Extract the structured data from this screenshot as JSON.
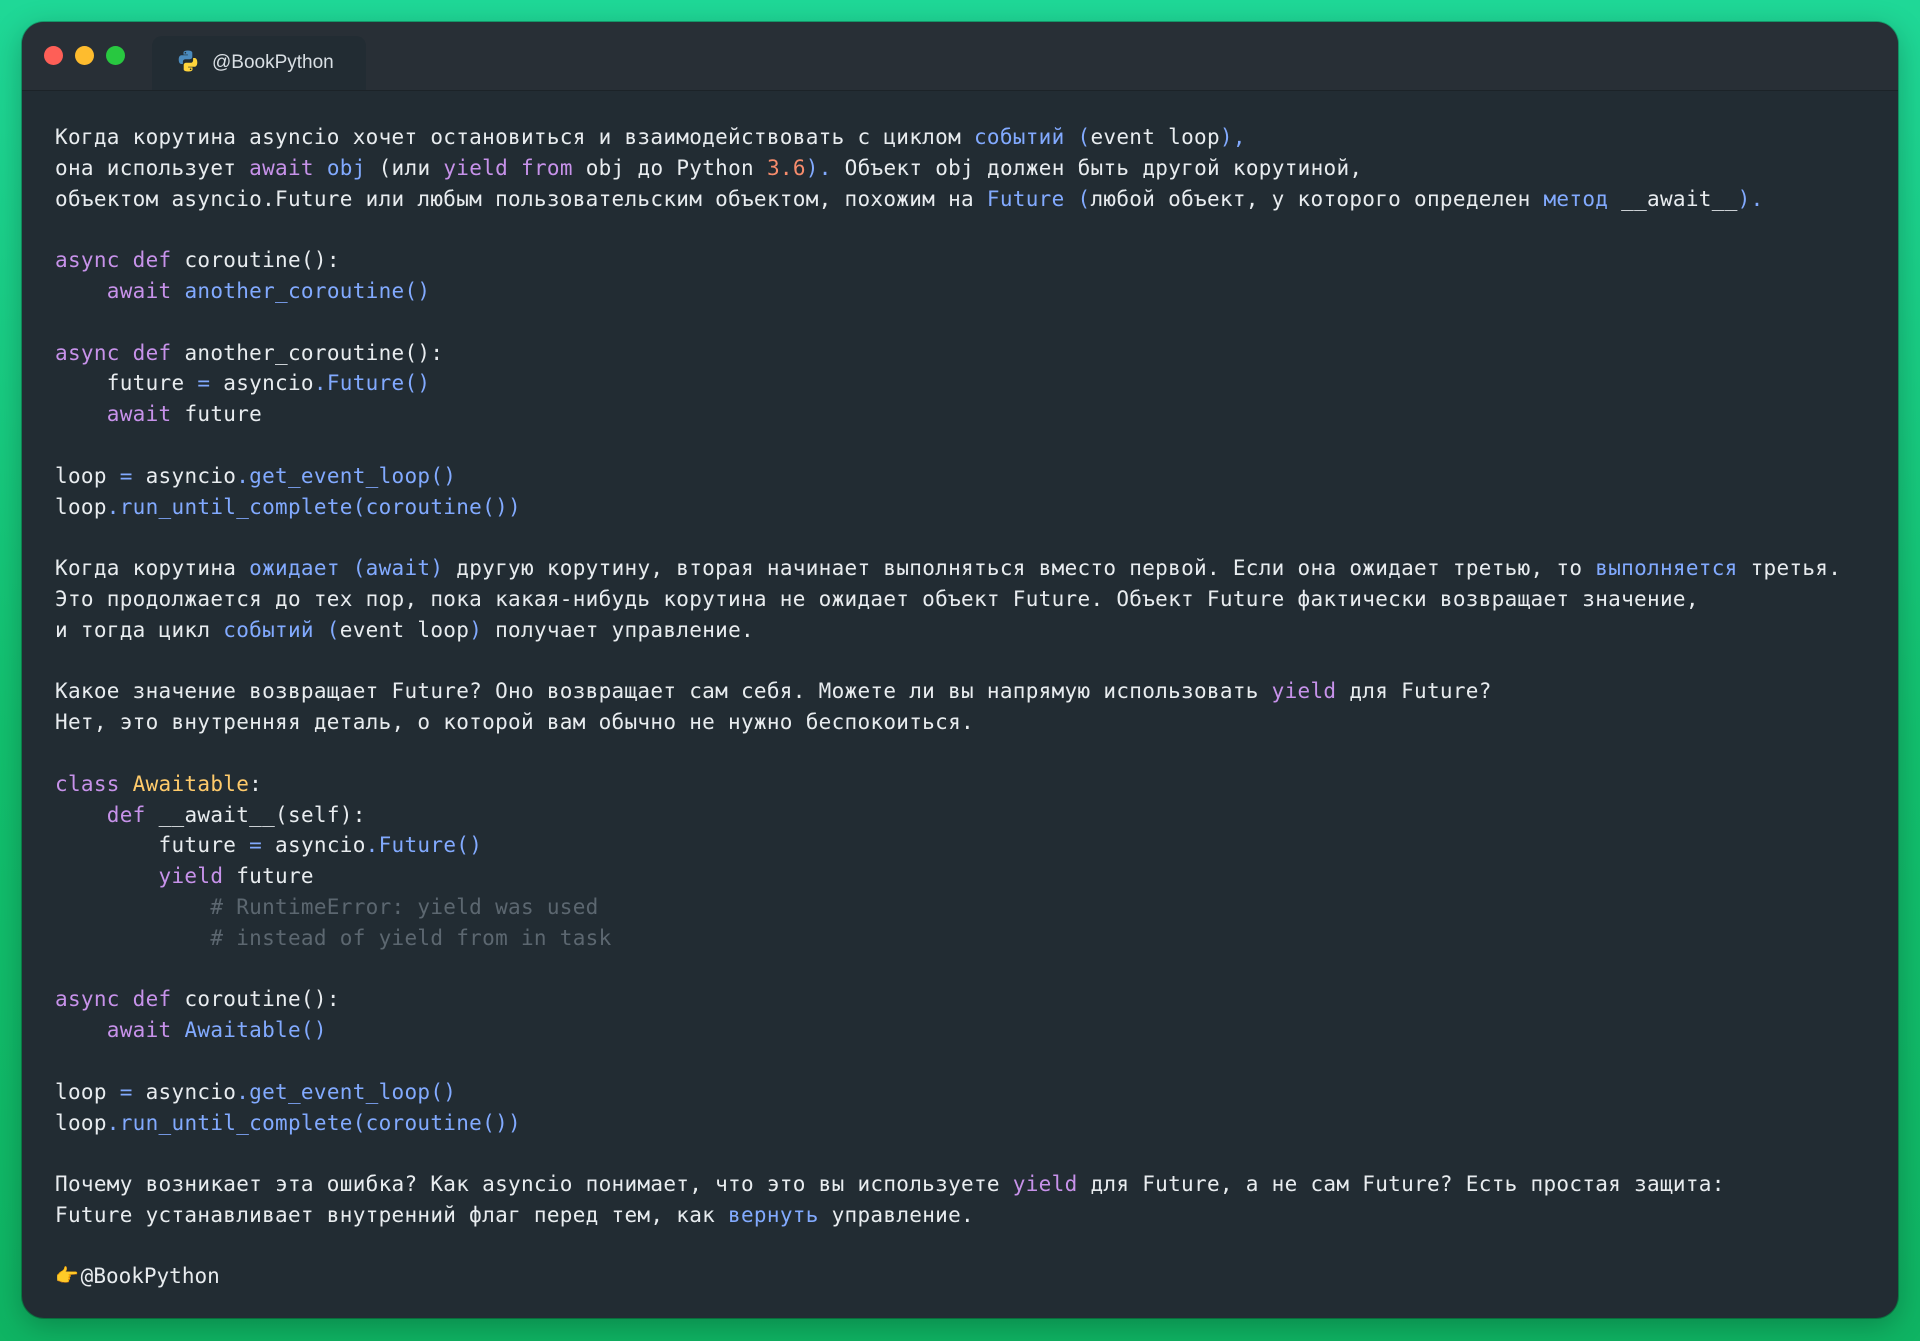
{
  "window": {
    "tab_title": "@BookPython"
  },
  "colors": {
    "text": "#e8ecef",
    "keyword": "#c792ea",
    "func": "#82aaff",
    "number": "#f78c6c",
    "class": "#ffcb6b",
    "comment": "#5c6770",
    "traffic_red": "#fe5f57",
    "traffic_yellow": "#febc2e",
    "traffic_green": "#28c840"
  },
  "lines": [
    [
      [
        "Когда корутина asyncio хочет остановиться и взаимодействовать с циклом ",
        "text"
      ],
      [
        "событий",
        "func"
      ],
      [
        " (",
        "func"
      ],
      [
        "event loop",
        "text"
      ],
      [
        "),",
        "func"
      ]
    ],
    [
      [
        "она использует ",
        "text"
      ],
      [
        "await",
        "keyword"
      ],
      [
        " ",
        "text"
      ],
      [
        "obj",
        "func"
      ],
      [
        " (или ",
        "text"
      ],
      [
        "yield from",
        "keyword"
      ],
      [
        " obj до Python ",
        "text"
      ],
      [
        "3.6",
        "number"
      ],
      [
        "). ",
        "func"
      ],
      [
        "Объект obj должен быть другой корутиной,",
        "text"
      ]
    ],
    [
      [
        "объектом asyncio.Future или любым пользовательским объектом, похожим на ",
        "text"
      ],
      [
        "Future",
        "func"
      ],
      [
        " (",
        "func"
      ],
      [
        "любой объект, у которого определен ",
        "text"
      ],
      [
        "метод",
        "func"
      ],
      [
        " __await__",
        "text"
      ],
      [
        ").",
        "func"
      ]
    ],
    [],
    [
      [
        "async def",
        "keyword"
      ],
      [
        " coroutine",
        "text"
      ],
      [
        "():",
        "text"
      ]
    ],
    [
      [
        "    ",
        "text"
      ],
      [
        "await",
        "keyword"
      ],
      [
        " another_coroutine()",
        "func"
      ]
    ],
    [],
    [
      [
        "async def",
        "keyword"
      ],
      [
        " another_coroutine():",
        "text"
      ]
    ],
    [
      [
        "    future ",
        "text"
      ],
      [
        "=",
        "func"
      ],
      [
        " asyncio",
        "text"
      ],
      [
        ".Future()",
        "func"
      ]
    ],
    [
      [
        "    ",
        "text"
      ],
      [
        "await",
        "keyword"
      ],
      [
        " future",
        "text"
      ]
    ],
    [],
    [
      [
        "loop ",
        "text"
      ],
      [
        "=",
        "func"
      ],
      [
        " asyncio",
        "text"
      ],
      [
        ".get_event_loop()",
        "func"
      ]
    ],
    [
      [
        "loop",
        "text"
      ],
      [
        ".run_until_complete(coroutine())",
        "func"
      ]
    ],
    [],
    [
      [
        "Когда корутина ",
        "text"
      ],
      [
        "ожидает (await)",
        "func"
      ],
      [
        " другую корутину, вторая начинает выполняться вместо первой. Если она ожидает третью, то ",
        "text"
      ],
      [
        "выполняется",
        "func"
      ],
      [
        " третья.",
        "text"
      ]
    ],
    [
      [
        "Это продолжается до тех пор, пока какая-нибудь корутина не ожидает объект Future. Объект Future фактически возвращает значение,",
        "text"
      ]
    ],
    [
      [
        "и тогда цикл ",
        "text"
      ],
      [
        "событий (",
        "func"
      ],
      [
        "event loop",
        "text"
      ],
      [
        ")",
        "func"
      ],
      [
        " получает управление.",
        "text"
      ]
    ],
    [],
    [
      [
        "Какое значение возвращает Future? Оно возвращает сам себя. Можете ли вы напрямую использовать ",
        "text"
      ],
      [
        "yield",
        "keyword"
      ],
      [
        " для Future?",
        "text"
      ]
    ],
    [
      [
        "Нет, это внутренняя деталь, о которой вам обычно не нужно беспокоиться.",
        "text"
      ]
    ],
    [],
    [
      [
        "class",
        "keyword"
      ],
      [
        " Awaitable",
        "class"
      ],
      [
        ":",
        "text"
      ]
    ],
    [
      [
        "    ",
        "text"
      ],
      [
        "def",
        "keyword"
      ],
      [
        " __await__(self):",
        "text"
      ]
    ],
    [
      [
        "        future ",
        "text"
      ],
      [
        "=",
        "func"
      ],
      [
        " asyncio",
        "text"
      ],
      [
        ".Future()",
        "func"
      ]
    ],
    [
      [
        "        ",
        "text"
      ],
      [
        "yield",
        "keyword"
      ],
      [
        " future",
        "text"
      ]
    ],
    [
      [
        "            # RuntimeError: yield was used",
        "comment"
      ]
    ],
    [
      [
        "            # instead of yield from in task",
        "comment"
      ]
    ],
    [],
    [
      [
        "async def",
        "keyword"
      ],
      [
        " coroutine():",
        "text"
      ]
    ],
    [
      [
        "    ",
        "text"
      ],
      [
        "await",
        "keyword"
      ],
      [
        " Awaitable()",
        "func"
      ]
    ],
    [],
    [
      [
        "loop ",
        "text"
      ],
      [
        "=",
        "func"
      ],
      [
        " asyncio",
        "text"
      ],
      [
        ".get_event_loop()",
        "func"
      ]
    ],
    [
      [
        "loop",
        "text"
      ],
      [
        ".run_until_complete(coroutine())",
        "func"
      ]
    ],
    [],
    [
      [
        "Почему возникает эта ошибка? Как asyncio понимает, что это вы используете ",
        "text"
      ],
      [
        "yield",
        "keyword"
      ],
      [
        " для Future, а не сам Future? Есть простая защита:",
        "text"
      ]
    ],
    [
      [
        "Future устанавливает внутренний флаг перед тем, как ",
        "text"
      ],
      [
        "вернуть",
        "func"
      ],
      [
        " управление.",
        "text"
      ]
    ],
    []
  ],
  "footer": {
    "emoji": "👉",
    "handle": "@BookPython"
  }
}
